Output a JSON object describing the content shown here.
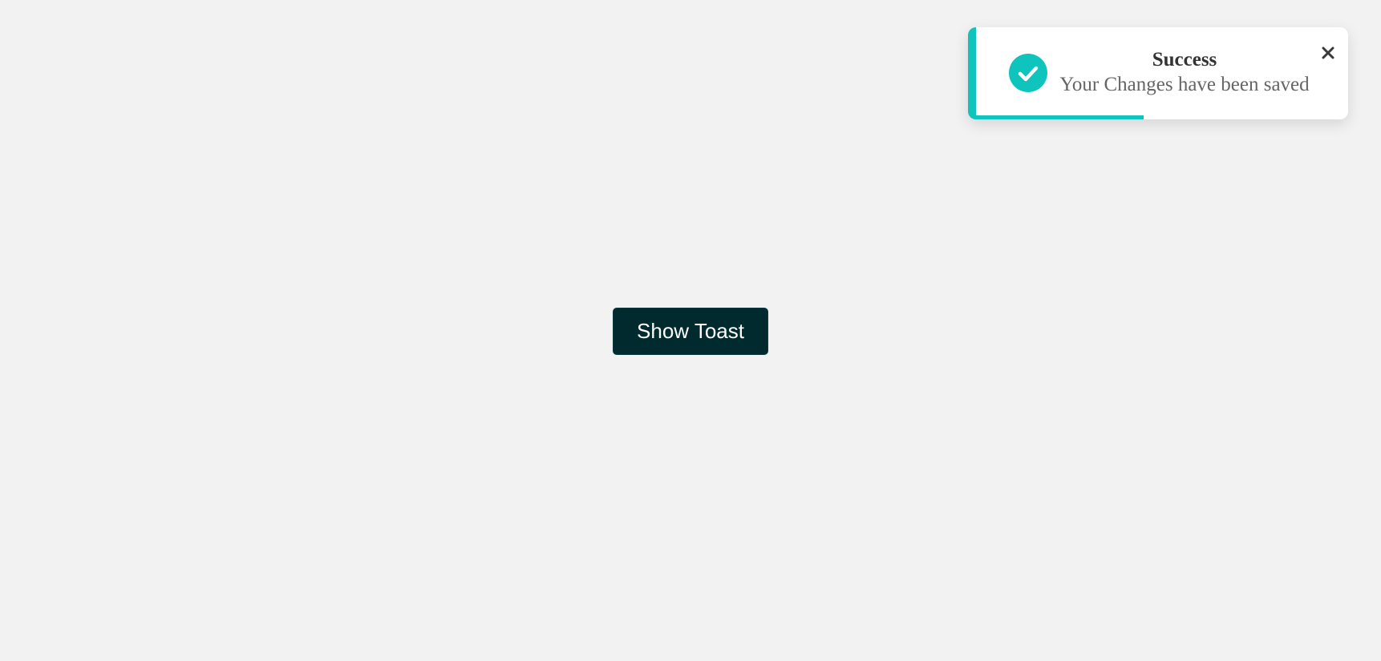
{
  "main": {
    "show_toast_label": "Show Toast"
  },
  "toast": {
    "title": "Success",
    "message": "Your Changes have been saved",
    "icon": "check-icon",
    "close_icon": "close-icon",
    "progress": 0.45,
    "accent_color": "#0fc4bc"
  },
  "colors": {
    "background": "#f2f2f2",
    "button_background": "#012a2f",
    "button_text": "#ffffff"
  }
}
